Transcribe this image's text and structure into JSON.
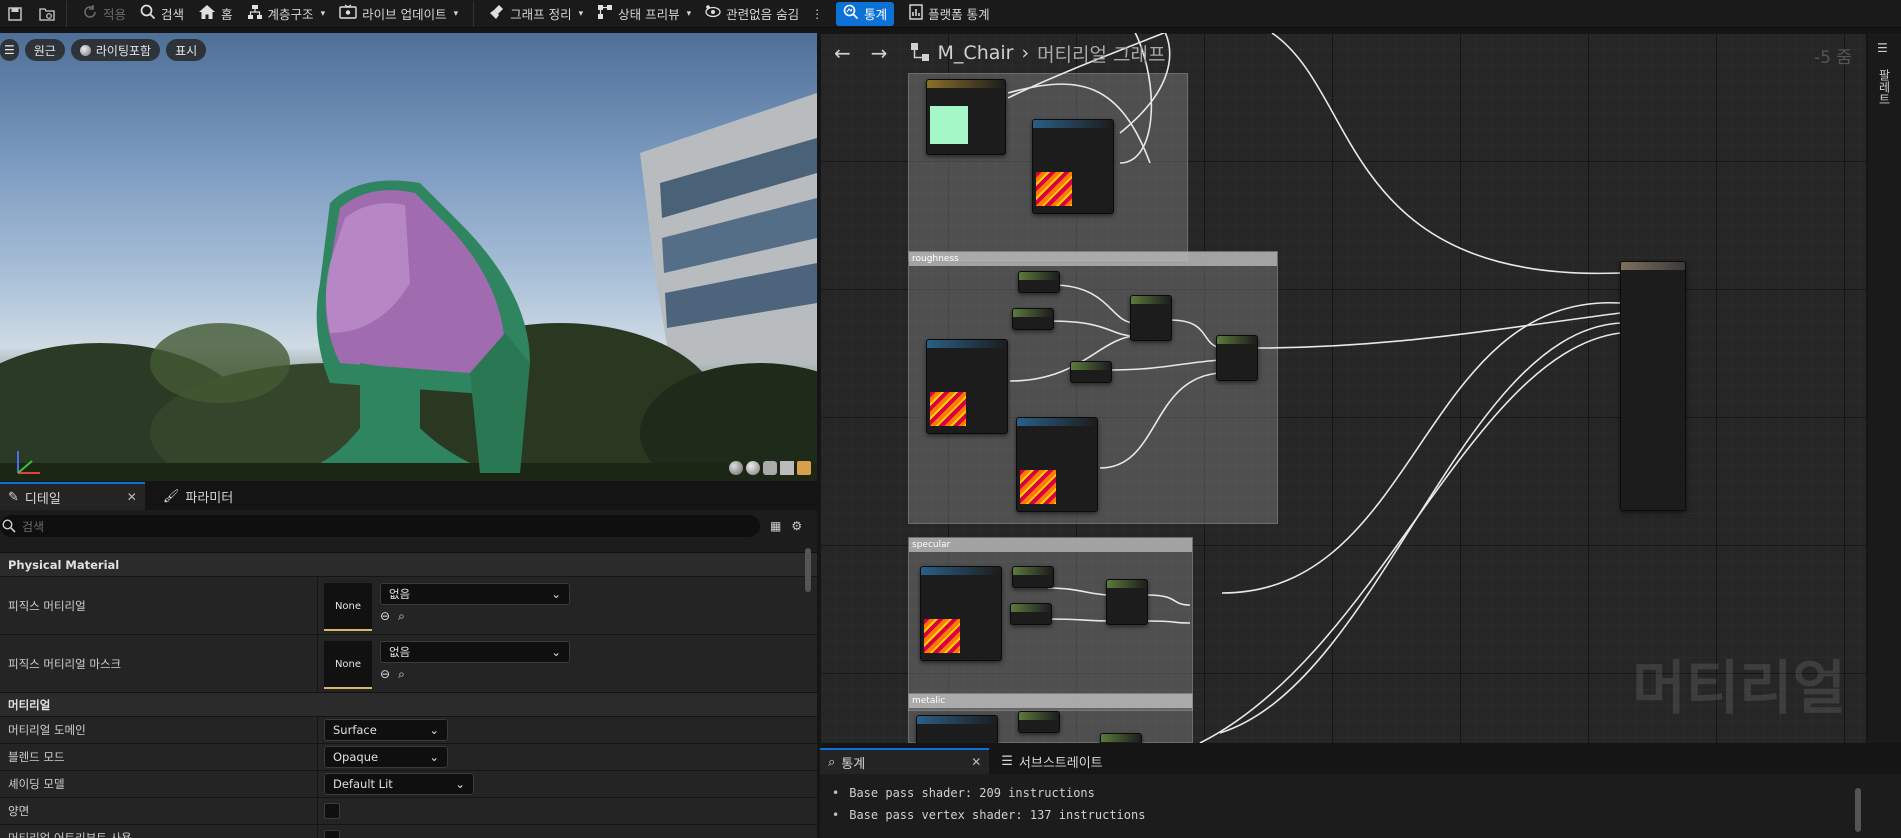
{
  "toolbar": {
    "items": [
      {
        "label": "적용",
        "icon": "apply-icon",
        "disabled": true
      },
      {
        "label": "검색",
        "icon": "search-icon"
      },
      {
        "label": "홈",
        "icon": "home-icon"
      },
      {
        "label": "계층구조",
        "icon": "hierarchy-icon",
        "dropdown": true
      },
      {
        "label": "라이브 업데이트",
        "icon": "live-update-icon",
        "dropdown": true
      },
      {
        "label": "그래프 정리",
        "icon": "broom-icon",
        "dropdown": true
      },
      {
        "label": "상태 프리뷰",
        "icon": "preview-icon",
        "dropdown": true
      },
      {
        "label": "관련없음 숨김",
        "icon": "hide-icon"
      },
      {
        "label": "통계",
        "icon": "stats-icon",
        "active": true
      },
      {
        "label": "플랫폼 통계",
        "icon": "platform-stats-icon"
      }
    ]
  },
  "viewport": {
    "pills": [
      "원근",
      "라이팅포함",
      "표시"
    ]
  },
  "details": {
    "tabs": [
      {
        "label": "디테일"
      },
      {
        "label": "파라미터"
      }
    ],
    "search_placeholder": "검색",
    "category_physical": "Physical Material",
    "phys_mat_label": "피직스 머티리얼",
    "phys_mat_mask_label": "피직스 머티리얼 마스크",
    "asset_none": "None",
    "combo_none": "없음",
    "category_material": "머티리얼",
    "domain_label": "머티리얼 도메인",
    "domain_value": "Surface",
    "blend_label": "블렌드 모드",
    "blend_value": "Opaque",
    "shading_label": "셰이딩 모델",
    "shading_value": "Default Lit",
    "twosided_label": "양면",
    "attr_label": "머티리얼 어트리뷰트 사용"
  },
  "graph": {
    "breadcrumb_material": "M_Chair",
    "breadcrumb_graph": "머티리얼 그래프",
    "zoom": "-5 줌",
    "watermark": "머티리얼",
    "comments": [
      "roughness",
      "specular",
      "metalic"
    ]
  },
  "right_strip": {
    "label": "팔레트"
  },
  "stats": {
    "tabs": [
      {
        "label": "통계"
      },
      {
        "label": "서브스트레이트"
      }
    ],
    "lines": [
      "Base pass shader: 209 instructions",
      "Base pass vertex shader: 137 instructions"
    ]
  }
}
